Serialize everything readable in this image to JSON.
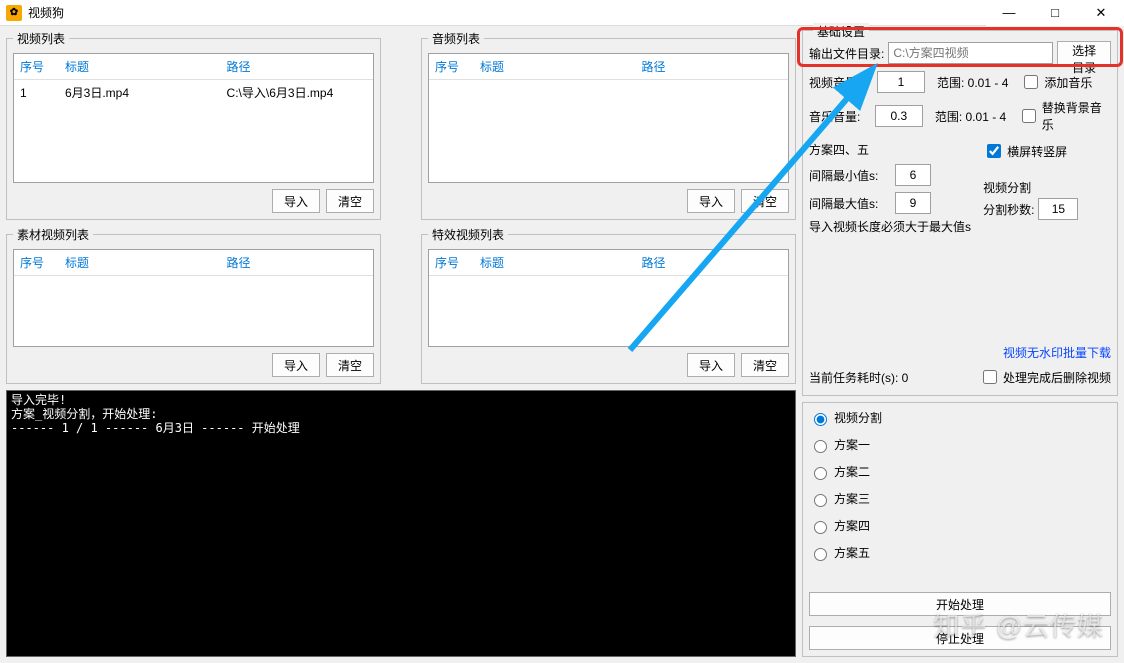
{
  "app": {
    "title": "视频狗"
  },
  "window": {
    "min": "—",
    "max": "□",
    "close": "✕"
  },
  "panels": {
    "video": {
      "legend": "视频列表"
    },
    "audio": {
      "legend": "音频列表"
    },
    "material": {
      "legend": "素材视频列表"
    },
    "effect": {
      "legend": "特效视频列表"
    }
  },
  "columns": {
    "seq": "序号",
    "title": "标题",
    "path": "路径"
  },
  "video_rows": [
    {
      "seq": "1",
      "title": "6月3日.mp4",
      "path": "C:\\导入\\6月3日.mp4"
    }
  ],
  "buttons": {
    "import": "导入",
    "clear": "清空",
    "choose_dir": "选择目录",
    "start": "开始处理",
    "stop": "停止处理"
  },
  "settings": {
    "legend": "基础设置",
    "output_label": "输出文件目录:",
    "output_placeholder": "C:\\方案四视频",
    "video_vol_label": "视频音量:",
    "video_vol_value": "1",
    "video_vol_range": "范围: 0.01 - 4",
    "music_vol_label": "音乐音量:",
    "music_vol_value": "0.3",
    "music_vol_range": "范围: 0.01 - 4",
    "add_music": "添加音乐",
    "replace_bgm": "替换背景音乐",
    "plan45_label": "方案四、五",
    "interval_min_label": "间隔最小值s:",
    "interval_min_value": "6",
    "interval_max_label": "间隔最大值s:",
    "interval_max_value": "9",
    "import_note": "导入视频长度必须大于最大值s",
    "landscape_to_portrait": "横屏转竖屏",
    "video_split_title": "视频分割",
    "split_seconds_label": "分割秒数:",
    "split_seconds_value": "15",
    "no_watermark_link": "视频无水印批量下载",
    "task_time_label": "当前任务耗时(s):",
    "task_time_value": "0",
    "delete_after": "处理完成后删除视频"
  },
  "plans": {
    "split": "视频分割",
    "p1": "方案一",
    "p2": "方案二",
    "p3": "方案三",
    "p4": "方案四",
    "p5": "方案五"
  },
  "console_text": "导入完毕!\n方案_视频分割，开始处理:\n------ 1 / 1 ------ 6月3日 ------ 开始处理",
  "watermark": "知乎 @云传媒"
}
